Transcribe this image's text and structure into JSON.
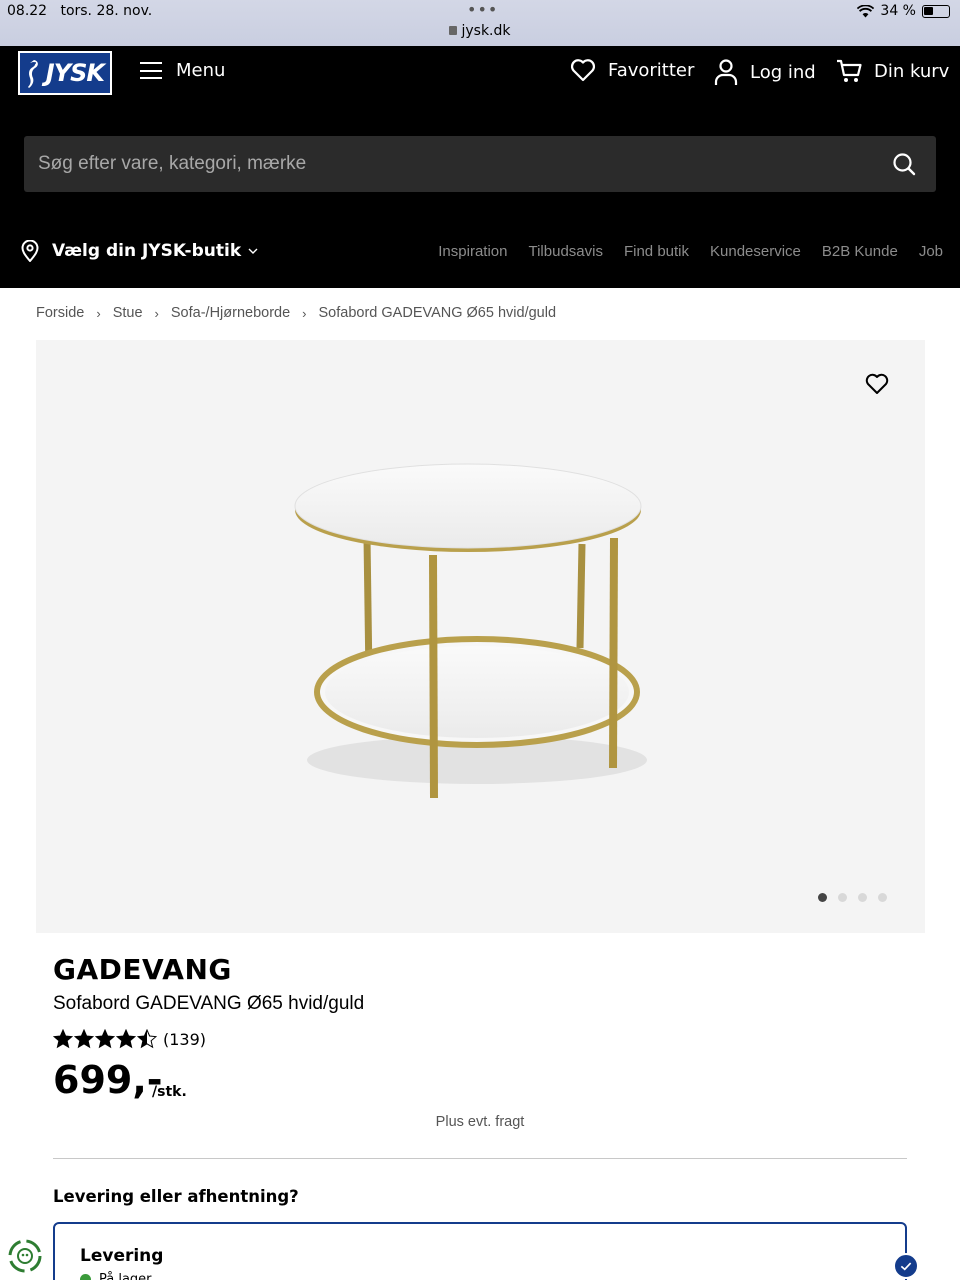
{
  "statusbar": {
    "time": "08.22",
    "date": "tors. 28. nov.",
    "url": "jysk.dk",
    "battery": "34 %"
  },
  "header": {
    "logo_text": "JYSK",
    "menu_label": "Menu",
    "favorites_label": "Favoritter",
    "login_label": "Log ind",
    "cart_label": "Din kurv",
    "search_placeholder": "Søg efter vare, kategori, mærke",
    "store_label": "Vælg din JYSK-butik",
    "subnav": [
      "Inspiration",
      "Tilbudsavis",
      "Find butik",
      "Kundeservice",
      "B2B Kunde",
      "Job"
    ]
  },
  "breadcrumb": [
    "Forside",
    "Stue",
    "Sofa-/Hjørneborde",
    "Sofabord GADEVANG Ø65 hvid/guld"
  ],
  "gallery": {
    "image_count": 4,
    "active_index": 0
  },
  "product": {
    "brand": "GADEVANG",
    "name": "Sofabord GADEVANG Ø65 hvid/guld",
    "rating": 4.5,
    "rating_max": 5,
    "review_count": "(139)",
    "price": "699,-",
    "unit": "/stk.",
    "shipping_note": "Plus evt. fragt"
  },
  "delivery": {
    "question": "Levering eller afhentning?",
    "option_label": "Levering",
    "stock_status": "På lager"
  },
  "colors": {
    "header_bg": "#000000",
    "brand_blue": "#143c8c",
    "gold": "#b9a04c",
    "stock_green": "#3a9a3a"
  }
}
